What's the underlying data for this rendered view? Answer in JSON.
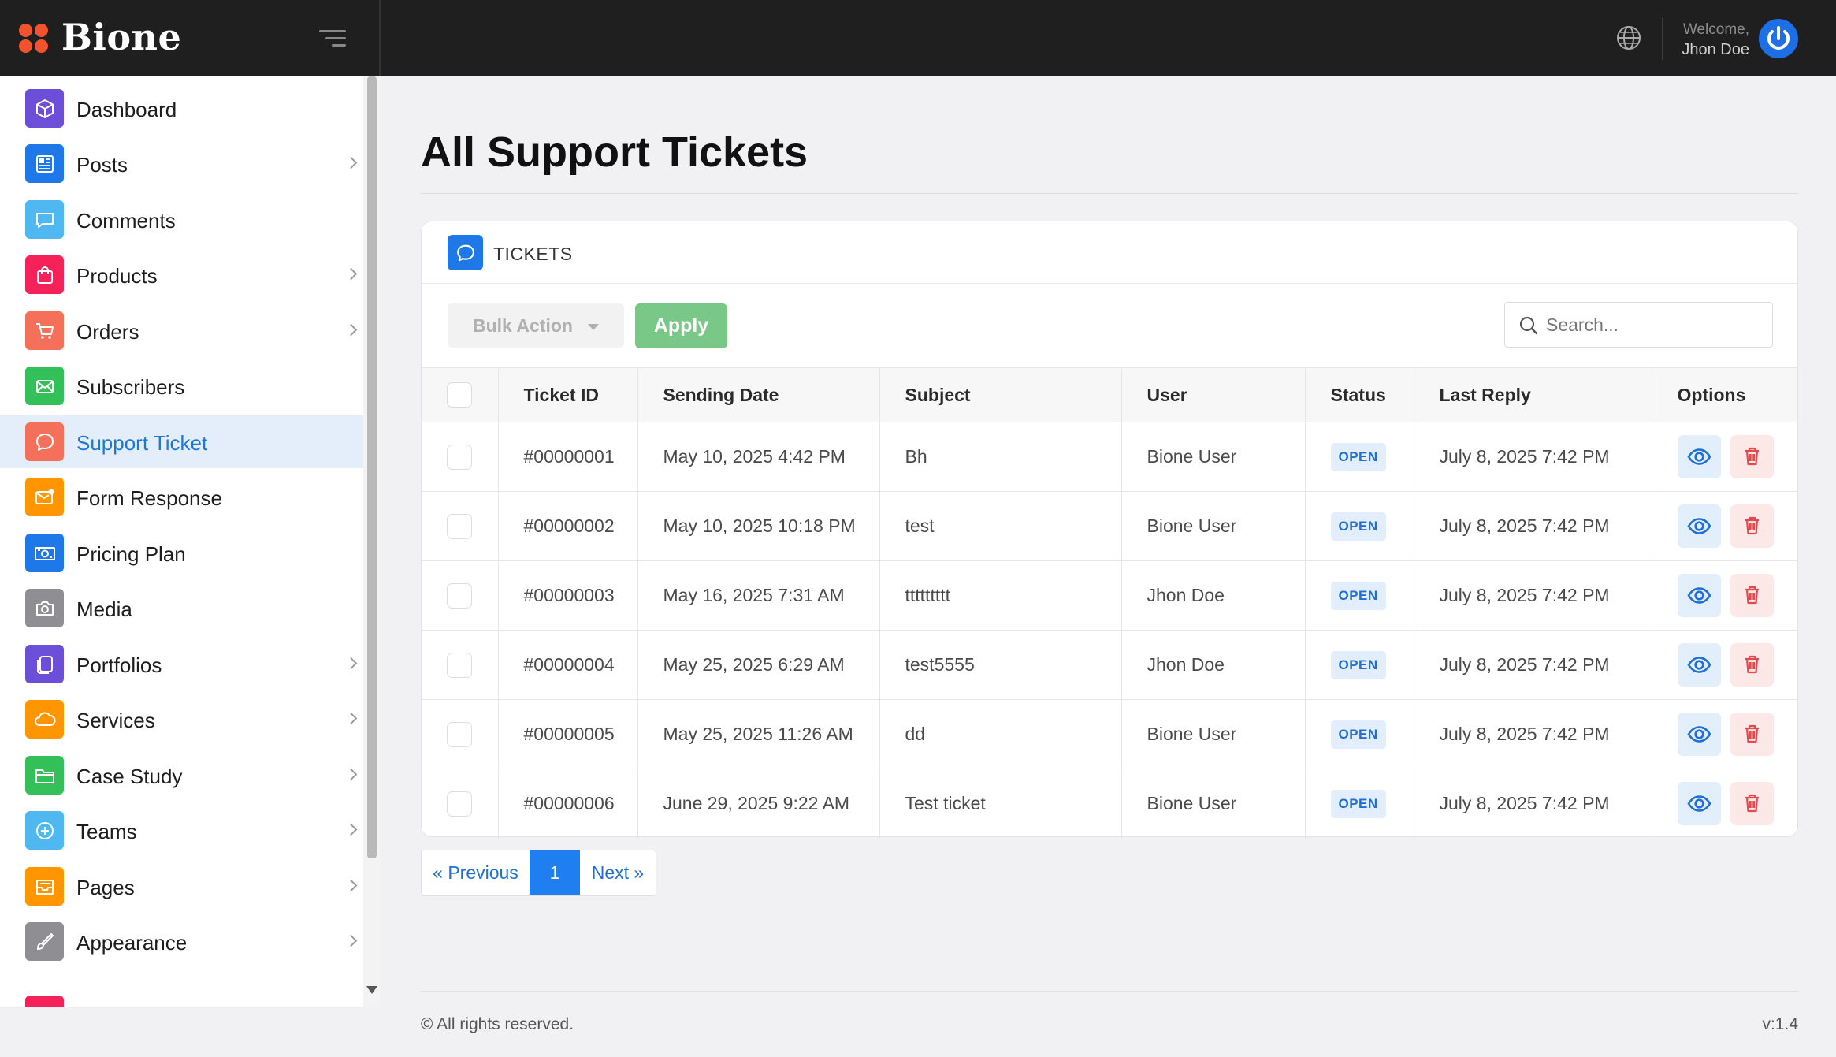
{
  "brand": {
    "name": "Bione",
    "logo_color": "#f0532d"
  },
  "header": {
    "welcome_label": "Welcome,",
    "user_name": "Jhon Doe",
    "avatar_color": "#1e6fe6"
  },
  "sidebar": {
    "items": [
      {
        "label": "Dashboard",
        "icon": "cube-icon",
        "color": "#6b4fd8",
        "submenu": false,
        "active": false
      },
      {
        "label": "Posts",
        "icon": "newspaper-icon",
        "color": "#1f78e8",
        "submenu": true,
        "active": false
      },
      {
        "label": "Comments",
        "icon": "chat-bubble-icon",
        "color": "#4fb8f0",
        "submenu": false,
        "active": false
      },
      {
        "label": "Products",
        "icon": "shopping-bag-icon",
        "color": "#f5225a",
        "submenu": true,
        "active": false
      },
      {
        "label": "Orders",
        "icon": "cart-icon",
        "color": "#f5705a",
        "submenu": true,
        "active": false
      },
      {
        "label": "Subscribers",
        "icon": "mail-icon",
        "color": "#34c058",
        "submenu": false,
        "active": false
      },
      {
        "label": "Support Ticket",
        "icon": "support-chat-icon",
        "color": "#f5705a",
        "submenu": false,
        "active": true
      },
      {
        "label": "Form Response",
        "icon": "envelope-badge-icon",
        "color": "#ff9500",
        "submenu": false,
        "active": false
      },
      {
        "label": "Pricing Plan",
        "icon": "banknote-icon",
        "color": "#1f78e8",
        "submenu": false,
        "active": false
      },
      {
        "label": "Media",
        "icon": "camera-icon",
        "color": "#8e8e93",
        "submenu": false,
        "active": false
      },
      {
        "label": "Portfolios",
        "icon": "stack-icon",
        "color": "#6b4fd8",
        "submenu": true,
        "active": false
      },
      {
        "label": "Services",
        "icon": "cloud-icon",
        "color": "#ff9500",
        "submenu": true,
        "active": false
      },
      {
        "label": "Case Study",
        "icon": "folder-icon",
        "color": "#34c058",
        "submenu": true,
        "active": false
      },
      {
        "label": "Teams",
        "icon": "plus-circle-icon",
        "color": "#4fb8f0",
        "submenu": true,
        "active": false
      },
      {
        "label": "Pages",
        "icon": "inbox-icon",
        "color": "#ff9500",
        "submenu": true,
        "active": false
      },
      {
        "label": "Appearance",
        "icon": "brush-icon",
        "color": "#8e8e93",
        "submenu": true,
        "active": false
      }
    ]
  },
  "main": {
    "title": "All Support Tickets",
    "card_title": "TICKETS",
    "bulk_action_label": "Bulk Action",
    "apply_label": "Apply",
    "search_placeholder": "Search...",
    "columns": [
      "Ticket ID",
      "Sending Date",
      "Subject",
      "User",
      "Status",
      "Last Reply",
      "Options"
    ],
    "rows": [
      {
        "id": "#00000001",
        "date": "May 10, 2025 4:42 PM",
        "subject": "Bh",
        "user": "Bione User",
        "status": "OPEN",
        "last_reply": "July 8, 2025 7:42 PM"
      },
      {
        "id": "#00000002",
        "date": "May 10, 2025 10:18 PM",
        "subject": "test",
        "user": "Bione User",
        "status": "OPEN",
        "last_reply": "July 8, 2025 7:42 PM"
      },
      {
        "id": "#00000003",
        "date": "May 16, 2025 7:31 AM",
        "subject": "ttttttttt",
        "user": "Jhon Doe",
        "status": "OPEN",
        "last_reply": "July 8, 2025 7:42 PM"
      },
      {
        "id": "#00000004",
        "date": "May 25, 2025 6:29 AM",
        "subject": "test5555",
        "user": "Jhon Doe",
        "status": "OPEN",
        "last_reply": "July 8, 2025 7:42 PM"
      },
      {
        "id": "#00000005",
        "date": "May 25, 2025 11:26 AM",
        "subject": "dd",
        "user": "Bione User",
        "status": "OPEN",
        "last_reply": "July 8, 2025 7:42 PM"
      },
      {
        "id": "#00000006",
        "date": "June 29, 2025 9:22 AM",
        "subject": "Test ticket",
        "user": "Bione User",
        "status": "OPEN",
        "last_reply": "July 8, 2025 7:42 PM"
      }
    ],
    "pagination": {
      "prev": "« Previous",
      "current": "1",
      "next": "Next »"
    }
  },
  "footer": {
    "copyright": "© All rights reserved.",
    "version": "v:1.4"
  }
}
